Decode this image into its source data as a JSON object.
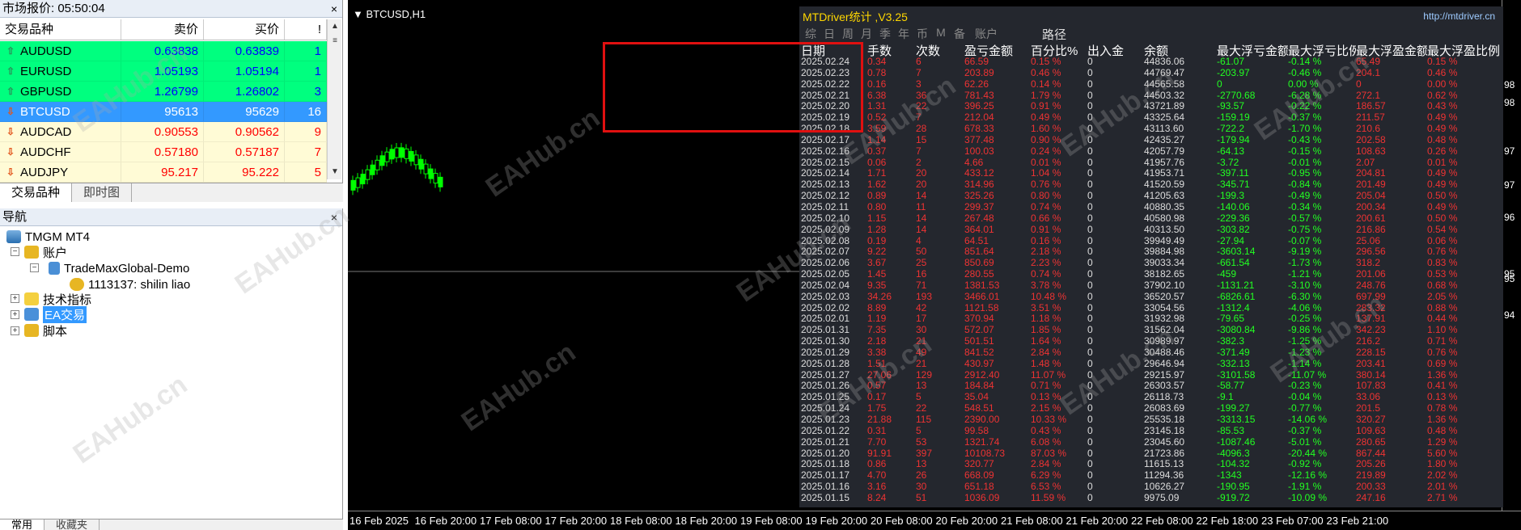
{
  "market_watch": {
    "title": "市场报价: 05:50:04",
    "close_label": "×",
    "columns": {
      "symbol": "交易品种",
      "bid": "卖价",
      "ask": "买价",
      "spread": "!"
    },
    "rows": [
      {
        "symbol": "AUDUSD",
        "bid": "0.63838",
        "ask": "0.63839",
        "spread": "1",
        "dir": "up"
      },
      {
        "symbol": "EURUSD",
        "bid": "1.05193",
        "ask": "1.05194",
        "spread": "1",
        "dir": "up"
      },
      {
        "symbol": "GBPUSD",
        "bid": "1.26799",
        "ask": "1.26802",
        "spread": "3",
        "dir": "up"
      },
      {
        "symbol": "BTCUSD",
        "bid": "95613",
        "ask": "95629",
        "spread": "16",
        "dir": "down"
      },
      {
        "symbol": "AUDCAD",
        "bid": "0.90553",
        "ask": "0.90562",
        "spread": "9",
        "dir": "down"
      },
      {
        "symbol": "AUDCHF",
        "bid": "0.57180",
        "ask": "0.57187",
        "spread": "7",
        "dir": "down"
      },
      {
        "symbol": "AUDJPY",
        "bid": "95.217",
        "ask": "95.222",
        "spread": "5",
        "dir": "down"
      }
    ],
    "tabs": [
      "交易品种",
      "即时图"
    ],
    "colors": {
      "up_row": "#00ff7f",
      "selected_row": "#3399ff",
      "down_row": "#fffbd6",
      "up_text": "#0000ff",
      "down_text": "#ff0000"
    }
  },
  "navigator": {
    "title": "导航",
    "close_label": "×",
    "tree": {
      "root": "TMGM MT4",
      "accounts": "账户",
      "server": "TradeMaxGlobal-Demo",
      "account": "1113137: shilin liao",
      "indicators": "技术指标",
      "ea": "EA交易",
      "scripts": "脚本"
    },
    "tabs": [
      "常用",
      "收藏夹"
    ]
  },
  "chart": {
    "symbol_label": "▼ BTCUSD,H1",
    "x_ticks": [
      "16 Feb 2025",
      "16 Feb 20:00",
      "17 Feb 08:00",
      "17 Feb 20:00",
      "18 Feb 08:00",
      "18 Feb 20:00",
      "19 Feb 08:00",
      "19 Feb 20:00",
      "20 Feb 08:00",
      "20 Feb 20:00",
      "21 Feb 08:00",
      "21 Feb 20:00",
      "22 Feb 08:00",
      "22 Feb 18:00",
      "23 Feb 07:00",
      "23 Feb 21:00"
    ],
    "y_ticks": [
      "98",
      "98",
      "97",
      "97",
      "96",
      "95",
      "95",
      "94"
    ],
    "watermark": "EAHub.cn"
  },
  "stats": {
    "title": "MTDriver统计  ,V3.25",
    "url": "http://mtdriver.cn",
    "buttons": [
      "综",
      "日",
      "周",
      "月",
      "季",
      "年",
      "币",
      "M",
      "备",
      "账户"
    ],
    "path_label": "路径",
    "columns": [
      "日期",
      "手数",
      "次数",
      "盈亏金额",
      "百分比%",
      "出入金",
      "余额",
      "最大浮亏金额",
      "最大浮亏比例",
      "最大浮盈金额",
      "最大浮盈比例"
    ],
    "rows": [
      [
        "2025.02.24",
        "0.34",
        "6",
        "66.59",
        "0.15 %",
        "0",
        "44836.06",
        "-61.07",
        "-0.14 %",
        "65.49",
        "0.15 %"
      ],
      [
        "2025.02.23",
        "0.78",
        "7",
        "203.89",
        "0.46 %",
        "0",
        "44769.47",
        "-203.97",
        "-0.46 %",
        "204.1",
        "0.46 %"
      ],
      [
        "2025.02.22",
        "0.16",
        "3",
        "62.26",
        "0.14 %",
        "0",
        "44565.58",
        "0",
        "0.00 %",
        "0",
        "0.00 %"
      ],
      [
        "2025.02.21",
        "6.38",
        "36",
        "781.43",
        "1.79 %",
        "0",
        "44503.32",
        "-2770.68",
        "-6.28 %",
        "272.1",
        "0.62 %"
      ],
      [
        "2025.02.20",
        "1.31",
        "22",
        "396.25",
        "0.91 %",
        "0",
        "43721.89",
        "-93.57",
        "-0.22 %",
        "186.57",
        "0.43 %"
      ],
      [
        "2025.02.19",
        "0.52",
        "7",
        "212.04",
        "0.49 %",
        "0",
        "43325.64",
        "-159.19",
        "-0.37 %",
        "211.57",
        "0.49 %"
      ],
      [
        "2025.02.18",
        "3.59",
        "28",
        "678.33",
        "1.60 %",
        "0",
        "43113.60",
        "-722.2",
        "-1.70 %",
        "210.6",
        "0.49 %"
      ],
      [
        "2025.02.17",
        "1.14",
        "15",
        "377.48",
        "0.90 %",
        "0",
        "42435.27",
        "-179.94",
        "-0.43 %",
        "202.58",
        "0.48 %"
      ],
      [
        "2025.02.16",
        "0.37",
        "7",
        "100.03",
        "0.24 %",
        "0",
        "42057.79",
        "-64.13",
        "-0.15 %",
        "108.63",
        "0.26 %"
      ],
      [
        "2025.02.15",
        "0.06",
        "2",
        "4.66",
        "0.01 %",
        "0",
        "41957.76",
        "-3.72",
        "-0.01 %",
        "2.07",
        "0.01 %"
      ],
      [
        "2025.02.14",
        "1.71",
        "20",
        "433.12",
        "1.04 %",
        "0",
        "41953.71",
        "-397.11",
        "-0.95 %",
        "204.81",
        "0.49 %"
      ],
      [
        "2025.02.13",
        "1.62",
        "20",
        "314.96",
        "0.76 %",
        "0",
        "41520.59",
        "-345.71",
        "-0.84 %",
        "201.49",
        "0.49 %"
      ],
      [
        "2025.02.12",
        "0.89",
        "14",
        "325.26",
        "0.80 %",
        "0",
        "41205.63",
        "-199.3",
        "-0.49 %",
        "205.04",
        "0.50 %"
      ],
      [
        "2025.02.11",
        "0.80",
        "11",
        "299.37",
        "0.74 %",
        "0",
        "40880.35",
        "-140.06",
        "-0.34 %",
        "200.34",
        "0.49 %"
      ],
      [
        "2025.02.10",
        "1.15",
        "14",
        "267.48",
        "0.66 %",
        "0",
        "40580.98",
        "-229.36",
        "-0.57 %",
        "200.61",
        "0.50 %"
      ],
      [
        "2025.02.09",
        "1.28",
        "14",
        "364.01",
        "0.91 %",
        "0",
        "40313.50",
        "-303.82",
        "-0.75 %",
        "216.86",
        "0.54 %"
      ],
      [
        "2025.02.08",
        "0.19",
        "4",
        "64.51",
        "0.16 %",
        "0",
        "39949.49",
        "-27.94",
        "-0.07 %",
        "25.06",
        "0.06 %"
      ],
      [
        "2025.02.07",
        "9.22",
        "50",
        "851.64",
        "2.18 %",
        "0",
        "39884.98",
        "-3603.14",
        "-9.19 %",
        "296.56",
        "0.76 %"
      ],
      [
        "2025.02.06",
        "3.67",
        "25",
        "850.69",
        "2.23 %",
        "0",
        "39033.34",
        "-661.54",
        "-1.73 %",
        "318.2",
        "0.83 %"
      ],
      [
        "2025.02.05",
        "1.45",
        "16",
        "280.55",
        "0.74 %",
        "0",
        "38182.65",
        "-459",
        "-1.21 %",
        "201.06",
        "0.53 %"
      ],
      [
        "2025.02.04",
        "9.35",
        "71",
        "1381.53",
        "3.78 %",
        "0",
        "37902.10",
        "-1131.21",
        "-3.10 %",
        "248.76",
        "0.68 %"
      ],
      [
        "2025.02.03",
        "34.26",
        "193",
        "3466.01",
        "10.48 %",
        "0",
        "36520.57",
        "-6826.61",
        "-6.30 %",
        "697.99",
        "2.05 %"
      ],
      [
        "2025.02.02",
        "8.89",
        "42",
        "1121.58",
        "3.51 %",
        "0",
        "33054.56",
        "-1312.4",
        "-4.06 %",
        "283.32",
        "0.88 %"
      ],
      [
        "2025.02.01",
        "1.19",
        "17",
        "370.94",
        "1.18 %",
        "0",
        "31932.98",
        "-79.65",
        "-0.25 %",
        "137.91",
        "0.44 %"
      ],
      [
        "2025.01.31",
        "7.35",
        "30",
        "572.07",
        "1.85 %",
        "0",
        "31562.04",
        "-3080.84",
        "-9.86 %",
        "342.23",
        "1.10 %"
      ],
      [
        "2025.01.30",
        "2.18",
        "21",
        "501.51",
        "1.64 %",
        "0",
        "30989.97",
        "-382.3",
        "-1.25 %",
        "216.2",
        "0.71 %"
      ],
      [
        "2025.01.29",
        "3.38",
        "49",
        "841.52",
        "2.84 %",
        "0",
        "30488.46",
        "-371.49",
        "-1.23 %",
        "228.15",
        "0.76 %"
      ],
      [
        "2025.01.28",
        "1.51",
        "21",
        "430.97",
        "1.48 %",
        "0",
        "29646.94",
        "-332.13",
        "-1.14 %",
        "203.41",
        "0.69 %"
      ],
      [
        "2025.01.27",
        "27.06",
        "129",
        "2912.40",
        "11.07 %",
        "0",
        "29215.97",
        "-3101.58",
        "-11.07 %",
        "380.14",
        "1.36 %"
      ],
      [
        "2025.01.26",
        "0.57",
        "13",
        "184.84",
        "0.71 %",
        "0",
        "26303.57",
        "-58.77",
        "-0.23 %",
        "107.83",
        "0.41 %"
      ],
      [
        "2025.01.25",
        "0.17",
        "5",
        "35.04",
        "0.13 %",
        "0",
        "26118.73",
        "-9.1",
        "-0.04 %",
        "33.06",
        "0.13 %"
      ],
      [
        "2025.01.24",
        "1.75",
        "22",
        "548.51",
        "2.15 %",
        "0",
        "26083.69",
        "-199.27",
        "-0.77 %",
        "201.5",
        "0.78 %"
      ],
      [
        "2025.01.23",
        "21.88",
        "115",
        "2390.00",
        "10.33 %",
        "0",
        "25535.18",
        "-3313.15",
        "-14.06 %",
        "320.27",
        "1.36 %"
      ],
      [
        "2025.01.22",
        "0.31",
        "5",
        "99.58",
        "0.43 %",
        "0",
        "23145.18",
        "-85.53",
        "-0.37 %",
        "109.63",
        "0.48 %"
      ],
      [
        "2025.01.21",
        "7.70",
        "53",
        "1321.74",
        "6.08 %",
        "0",
        "23045.60",
        "-1087.46",
        "-5.01 %",
        "280.65",
        "1.29 %"
      ],
      [
        "2025.01.20",
        "91.91",
        "397",
        "10108.73",
        "87.03 %",
        "0",
        "21723.86",
        "-4096.3",
        "-20.44 %",
        "867.44",
        "5.60 %"
      ],
      [
        "2025.01.18",
        "0.86",
        "13",
        "320.77",
        "2.84 %",
        "0",
        "11615.13",
        "-104.32",
        "-0.92 %",
        "205.26",
        "1.80 %"
      ],
      [
        "2025.01.17",
        "4.70",
        "26",
        "668.09",
        "6.29 %",
        "0",
        "11294.36",
        "-1343",
        "-12.16 %",
        "219.89",
        "2.02 %"
      ],
      [
        "2025.01.16",
        "3.16",
        "30",
        "651.18",
        "6.53 %",
        "0",
        "10626.27",
        "-190.95",
        "-1.91 %",
        "200.33",
        "2.01 %"
      ],
      [
        "2025.01.15",
        "8.24",
        "51",
        "1036.09",
        "11.59 %",
        "0",
        "9975.09",
        "-919.72",
        "-10.09 %",
        "247.16",
        "2.71 %"
      ]
    ],
    "highlight_color": "#e01010"
  }
}
